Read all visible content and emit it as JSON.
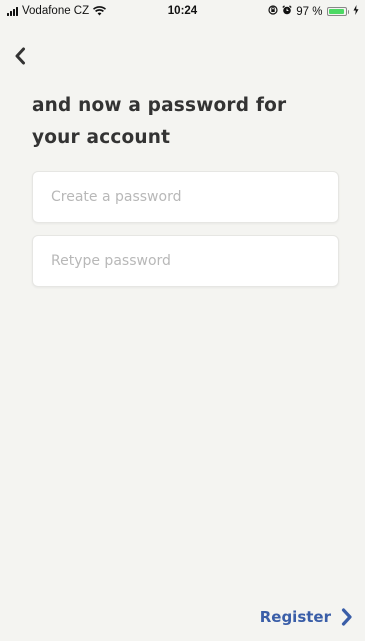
{
  "status_bar": {
    "carrier": "Vodafone CZ",
    "time": "10:24",
    "battery": "97 %",
    "battery_level": 0.97,
    "battery_color": "#4cd964"
  },
  "header": {
    "back_icon": "chevron-left-icon"
  },
  "title": "and now a password for your account",
  "form": {
    "password": {
      "value": "",
      "placeholder": "Create a password"
    },
    "retype": {
      "value": "",
      "placeholder": "Retype password"
    }
  },
  "footer": {
    "register_label": "Register",
    "register_icon": "chevron-right-icon",
    "accent_color": "#3a5ea8"
  }
}
